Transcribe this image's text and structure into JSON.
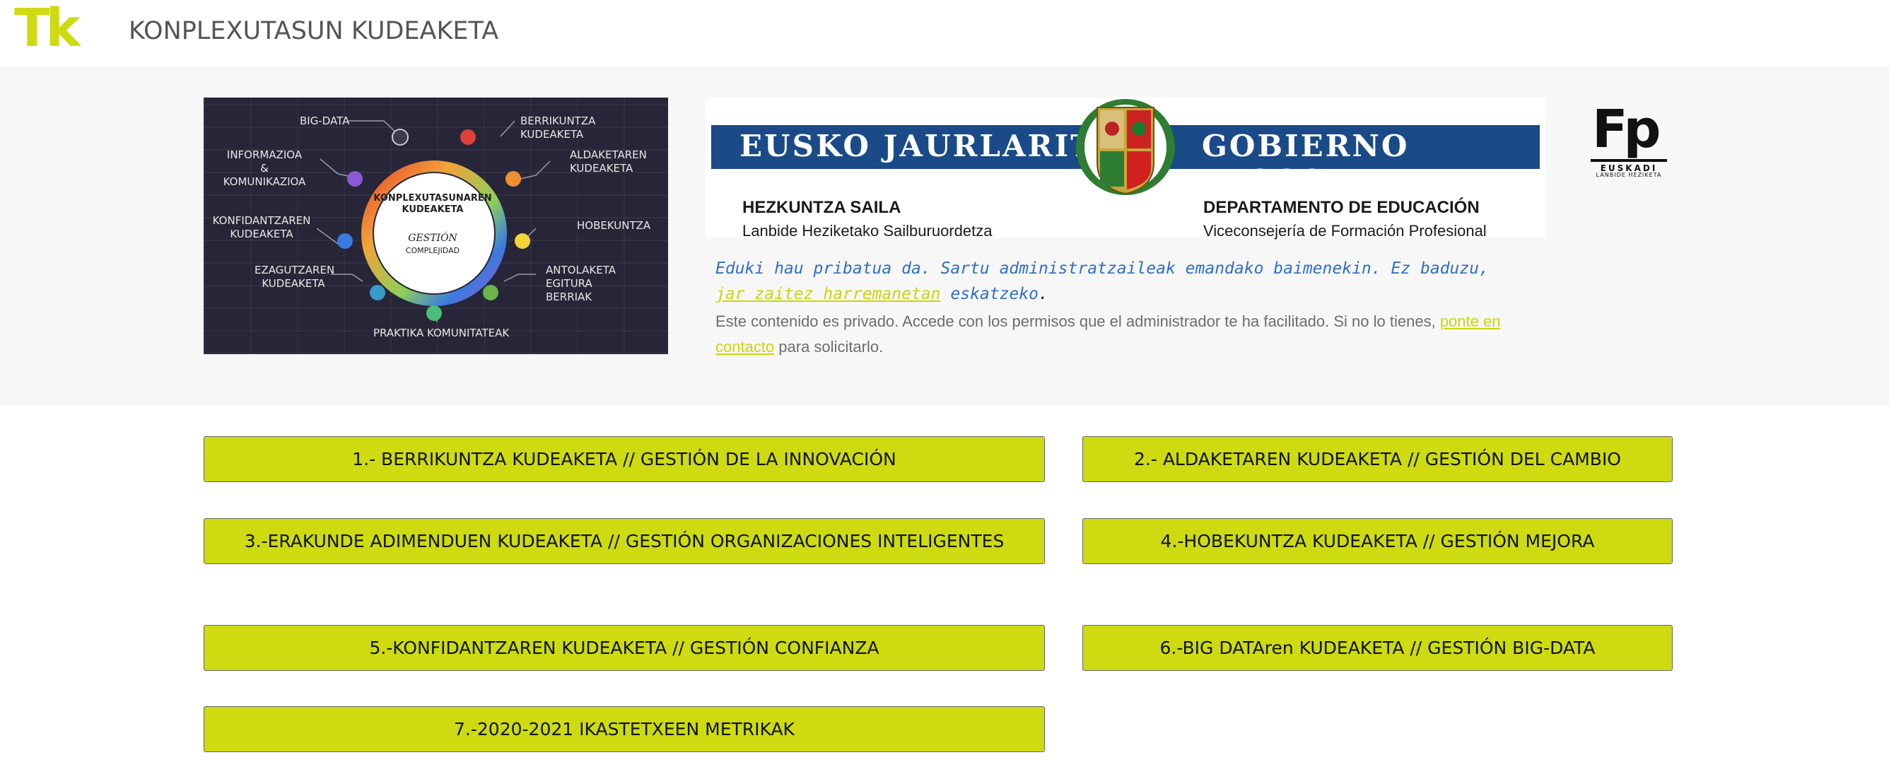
{
  "header": {
    "logo_text": "Tk",
    "title": "KONPLEXUTASUN KUDEAKETA"
  },
  "infographic": {
    "center_title": "KONPLEXUTASUNAREN KUDEAKETA",
    "center_sub": "GESTIÓN",
    "center_sub2": "COMPLEJIDAD",
    "labels": {
      "big_data": "BIG-DATA",
      "berrikuntza": "BERRIKUNTZA KUDEAKETA",
      "informazioa": "INFORMAZIOA & KOMUNIKAZIOA",
      "aldaketaren": "ALDAKETAREN KUDEAKETA",
      "konfidantzaren": "KONFIDANTZAREN KUDEAKETA",
      "hobekuntza": "HOBEKUNTZA",
      "ezagutzaren": "EZAGUTZAREN KUDEAKETA",
      "antolaketa": "ANTOLAKETA EGITURA BERRIAK",
      "praktika": "PRAKTIKA KOMUNITATEAK"
    },
    "colors": {
      "ring_start": "#e8462a",
      "ring_mid": "#f2a23a",
      "ring_end": "#8fcf5a",
      "ring_violet": "#8a5ad6",
      "ring_blue": "#3a7be0"
    }
  },
  "gov_banner": {
    "left_name": "EUSKO JAURLARITZA",
    "right_name": "GOBIERNO VASCO",
    "left_dept": "HEZKUNTZA SAILA",
    "left_sub": "Lanbide Heziketako Sailburuordetza",
    "right_dept": "DEPARTAMENTO DE EDUCACIÓN",
    "right_sub": "Viceconsejería de Formación Profesional",
    "strip_color": "#1a4a87"
  },
  "fp_logo": {
    "mark": "Fp",
    "region": "EUSKADI",
    "tagline": "LANBIDE HEZIKETA"
  },
  "notice": {
    "eu_text": "Eduki hau pribatua da. Sartu administratzaileak emandako baimenekin. Ez baduzu, ",
    "eu_link": "jar zaitez harremanetan",
    "eu_after": " eskatzeko",
    "eu_dot": ".",
    "es_text": "Este contenido es privado. Accede con los permisos que el administrador te ha facilitado. Si no lo tienes, ",
    "es_link": "ponte en contacto",
    "es_after": " para solicitarlo."
  },
  "buttons": {
    "b1": "1.- BERRIKUNTZA KUDEAKETA // GESTIÓN DE LA INNOVACIÓN",
    "b2": "2.- ALDAKETAREN KUDEAKETA // GESTIÓN DEL CAMBIO",
    "b3": "3.-ERAKUNDE ADIMENDUEN KUDEAKETA // GESTIÓN ORGANIZACIONES INTELIGENTES",
    "b4": "4.-HOBEKUNTZA KUDEAKETA // GESTIÓN MEJORA",
    "b5": "5.-KONFIDANTZAREN KUDEAKETA // GESTIÓN CONFIANZA",
    "b6": "6.-BIG DATAren KUDEAKETA // GESTIÓN BIG-DATA",
    "b7": "7.-2020-2021 IKASTETXEEN METRIKAK"
  },
  "colors": {
    "accent": "#cddb10",
    "link_blue": "#2f6fc7",
    "hero_bg": "#f7f7f7"
  }
}
